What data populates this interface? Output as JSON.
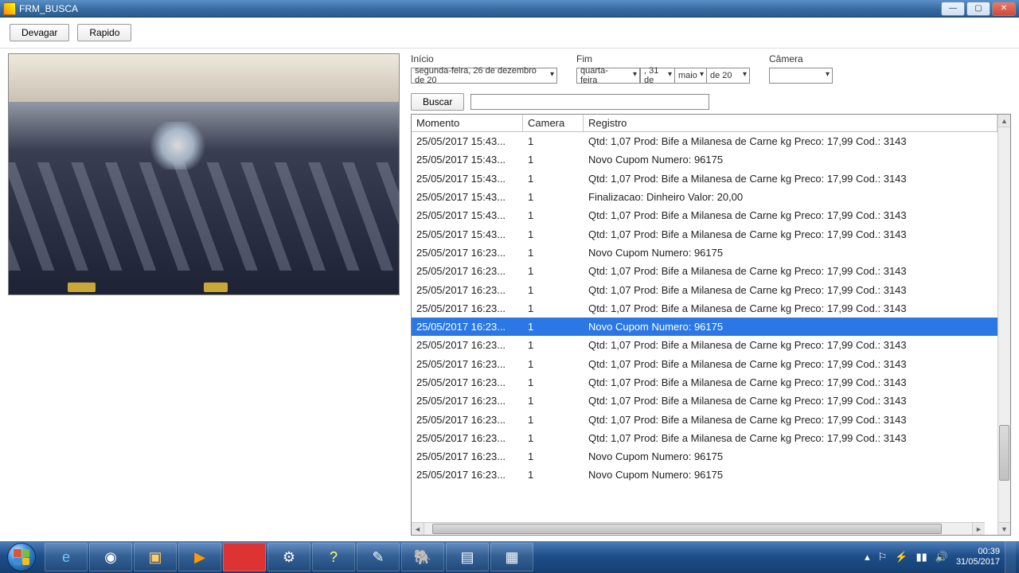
{
  "window": {
    "title": "FRM_BUSCA"
  },
  "toolbar": {
    "devagar": "Devagar",
    "rapido": "Rapido"
  },
  "filters": {
    "inicio_label": "Início",
    "inicio_value": "segunda-feira, 26 de dezembro de 20",
    "fim_label": "Fim",
    "fim_v1": "quarta-feira",
    "fim_v2": ", 31 de",
    "fim_v3": "maio",
    "fim_v4": "de 20",
    "camera_label": "Câmera",
    "camera_value": "",
    "buscar": "Buscar",
    "search_value": ""
  },
  "grid": {
    "headers": {
      "momento": "Momento",
      "camera": "Camera",
      "registro": "Registro"
    },
    "selected_index": 10,
    "rows": [
      {
        "momento": "25/05/2017 15:43...",
        "camera": "1",
        "registro": "Qtd: 1,07 Prod: Bife a Milanesa de Carne  kg Preco: 17,99 Cod.: 3143"
      },
      {
        "momento": "25/05/2017 15:43...",
        "camera": "1",
        "registro": "Novo Cupom Numero: 96175"
      },
      {
        "momento": "25/05/2017 15:43...",
        "camera": "1",
        "registro": "Qtd: 1,07 Prod: Bife a Milanesa de Carne  kg Preco: 17,99 Cod.: 3143"
      },
      {
        "momento": "25/05/2017 15:43...",
        "camera": "1",
        "registro": "Finalizacao: Dinheiro Valor: 20,00"
      },
      {
        "momento": "25/05/2017 15:43...",
        "camera": "1",
        "registro": "Qtd: 1,07 Prod: Bife a Milanesa de Carne  kg Preco: 17,99 Cod.: 3143"
      },
      {
        "momento": "25/05/2017 15:43...",
        "camera": "1",
        "registro": "Qtd: 1,07 Prod: Bife a Milanesa de Carne  kg Preco: 17,99 Cod.: 3143"
      },
      {
        "momento": "25/05/2017 16:23...",
        "camera": "1",
        "registro": "Novo Cupom Numero: 96175"
      },
      {
        "momento": "25/05/2017 16:23...",
        "camera": "1",
        "registro": "Qtd: 1,07 Prod: Bife a Milanesa de Carne  kg Preco: 17,99 Cod.: 3143"
      },
      {
        "momento": "25/05/2017 16:23...",
        "camera": "1",
        "registro": "Qtd: 1,07 Prod: Bife a Milanesa de Carne  kg Preco: 17,99 Cod.: 3143"
      },
      {
        "momento": "25/05/2017 16:23...",
        "camera": "1",
        "registro": "Qtd: 1,07 Prod: Bife a Milanesa de Carne  kg Preco: 17,99 Cod.: 3143"
      },
      {
        "momento": "25/05/2017 16:23...",
        "camera": "1",
        "registro": "Novo Cupom Numero: 96175"
      },
      {
        "momento": "25/05/2017 16:23...",
        "camera": "1",
        "registro": "Qtd: 1,07 Prod: Bife a Milanesa de Carne  kg Preco: 17,99 Cod.: 3143"
      },
      {
        "momento": "25/05/2017 16:23...",
        "camera": "1",
        "registro": "Qtd: 1,07 Prod: Bife a Milanesa de Carne  kg Preco: 17,99 Cod.: 3143"
      },
      {
        "momento": "25/05/2017 16:23...",
        "camera": "1",
        "registro": "Qtd: 1,07 Prod: Bife a Milanesa de Carne  kg Preco: 17,99 Cod.: 3143"
      },
      {
        "momento": "25/05/2017 16:23...",
        "camera": "1",
        "registro": "Qtd: 1,07 Prod: Bife a Milanesa de Carne  kg Preco: 17,99 Cod.: 3143"
      },
      {
        "momento": "25/05/2017 16:23...",
        "camera": "1",
        "registro": "Qtd: 1,07 Prod: Bife a Milanesa de Carne  kg Preco: 17,99 Cod.: 3143"
      },
      {
        "momento": "25/05/2017 16:23...",
        "camera": "1",
        "registro": "Qtd: 1,07 Prod: Bife a Milanesa de Carne  kg Preco: 17,99 Cod.: 3143"
      },
      {
        "momento": "25/05/2017 16:23...",
        "camera": "1",
        "registro": "Novo Cupom Numero: 96175"
      },
      {
        "momento": "25/05/2017 16:23...",
        "camera": "1",
        "registro": "Novo Cupom Numero: 96175"
      }
    ]
  },
  "taskbar": {
    "time": "00:39",
    "date": "31/05/2017"
  }
}
